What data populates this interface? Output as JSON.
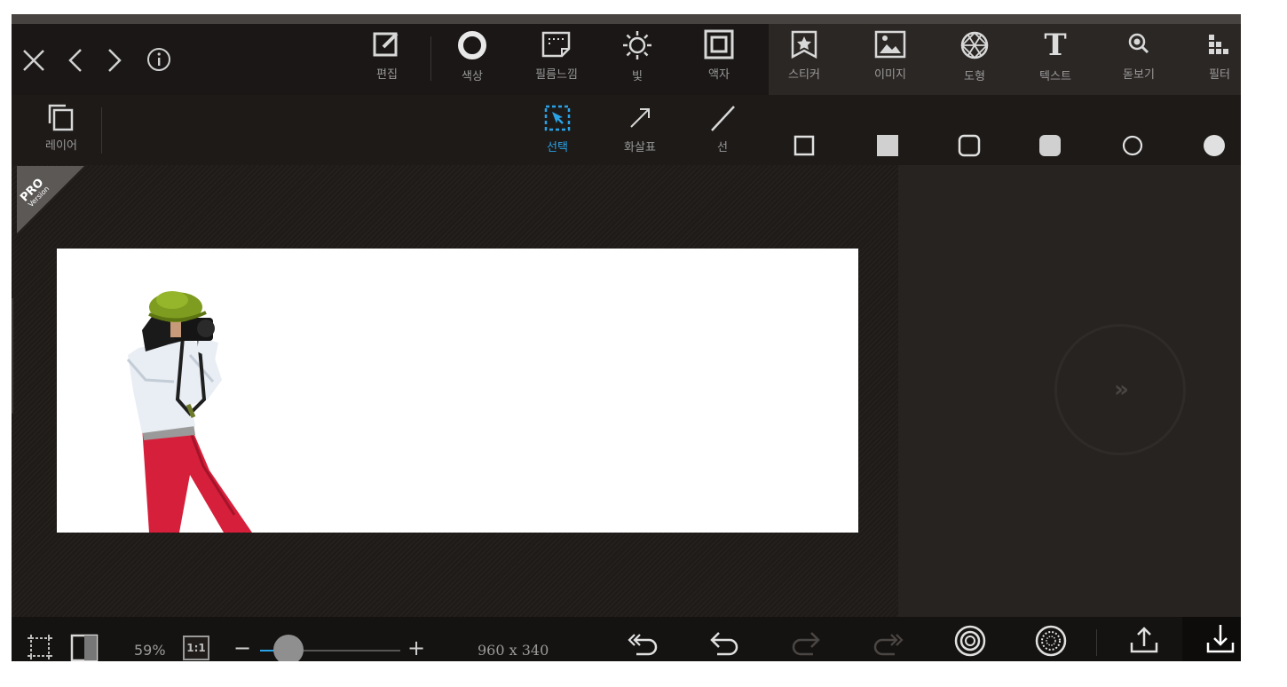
{
  "nav": {
    "close_icon": "close-icon",
    "back_icon": "chevron-left-icon",
    "forward_icon": "chevron-right-icon",
    "info_icon": "info-icon"
  },
  "toolbar_main": [
    {
      "label": "편집",
      "icon": "edit-icon"
    },
    {
      "label": "색상",
      "icon": "color-icon"
    },
    {
      "label": "필름느낌",
      "icon": "film-icon"
    },
    {
      "label": "빛",
      "icon": "light-icon"
    },
    {
      "label": "액자",
      "icon": "frame-icon"
    }
  ],
  "toolbar_right": [
    {
      "label": "스티커",
      "icon": "sticker-icon"
    },
    {
      "label": "이미지",
      "icon": "image-icon"
    },
    {
      "label": "도형",
      "icon": "shape-icon"
    },
    {
      "label": "텍스트",
      "icon": "text-icon"
    },
    {
      "label": "돋보기",
      "icon": "magnifier-icon"
    },
    {
      "label": "필터",
      "icon": "filter-icon"
    }
  ],
  "text_icon_glyph": "T",
  "layer": {
    "label": "레이어",
    "icon": "layers-icon"
  },
  "shape_tools": [
    {
      "label": "선택",
      "icon": "select-icon",
      "active": true
    },
    {
      "label": "화살표",
      "icon": "arrow-icon",
      "active": false
    },
    {
      "label": "선",
      "icon": "line-icon",
      "active": false
    }
  ],
  "shape_styles": [
    "square-outline-icon",
    "square-filled-icon",
    "rounded-square-outline-icon",
    "rounded-square-filled-icon",
    "circle-outline-icon",
    "circle-filled-icon"
  ],
  "badge": {
    "line1": "PRO",
    "line2": "Version"
  },
  "next_button": "»",
  "bottom": {
    "zoom_percent": "59%",
    "actual_size_label": "1:1",
    "zoom_level": 0.2,
    "minus": "−",
    "plus": "+",
    "dimensions": "960 x 340"
  },
  "colors": {
    "accent": "#2aa3e6",
    "background": "#221e1c"
  }
}
